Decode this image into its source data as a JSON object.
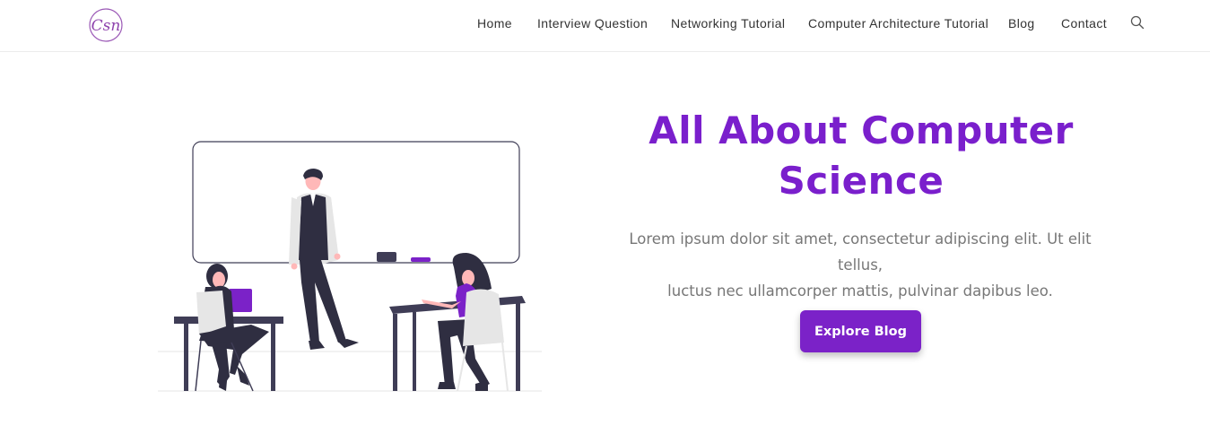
{
  "header": {
    "logo_text": "Csn",
    "nav": [
      {
        "label": "Home"
      },
      {
        "label": "Interview Question"
      },
      {
        "label": "Networking Tutorial"
      },
      {
        "label": "Computer Architecture Tutorial"
      },
      {
        "label": "Blog"
      },
      {
        "label": "Contact"
      }
    ],
    "search_icon": "search-icon"
  },
  "hero": {
    "title_line1": "All About Computer",
    "title_line2": "Science",
    "text_line1": "Lorem ipsum dolor sit amet, consectetur adipiscing elit. Ut elit tellus,",
    "text_line2": "luctus nec ullamcorper mattis, pulvinar dapibus leo.",
    "button_label": "Explore Blog"
  },
  "colors": {
    "accent": "#7b22c8",
    "title": "#7a1fcc",
    "dark": "#2f2e41",
    "text": "#777777"
  }
}
